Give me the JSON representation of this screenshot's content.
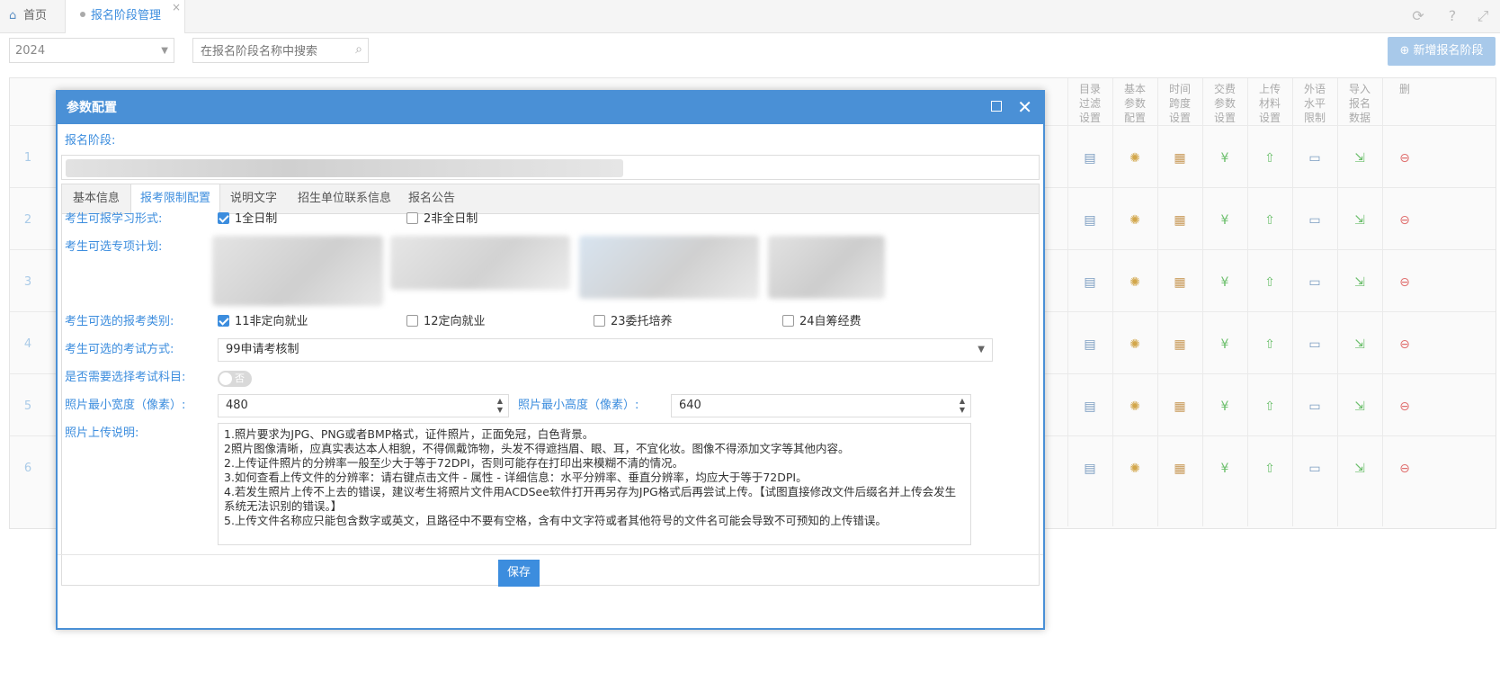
{
  "tabs": {
    "home": "首页",
    "active": "报名阶段管理"
  },
  "toolbar": {
    "year": "2024",
    "search_placeholder": "在报名阶段名称中搜索",
    "add_label": "新增报名阶段"
  },
  "grid": {
    "columns": [
      "目录\n过滤\n设置",
      "基本\n参数\n配置",
      "时间\n跨度\n设置",
      "交费\n参数\n设置",
      "上传\n材料\n设置",
      "外语\n水平\n限制",
      "导入\n报名\n数据",
      "删"
    ],
    "rows": [
      "1",
      "2",
      "3",
      "4",
      "5",
      "6"
    ]
  },
  "modal": {
    "title": "参数配置",
    "stage_label": "报名阶段:",
    "tabs": [
      "基本信息",
      "报考限制配置",
      "说明文字",
      "招生单位联系信息",
      "报名公告"
    ],
    "study_form_label": "考生可报学习形式:",
    "study_forms": [
      {
        "label": "1全日制",
        "checked": true
      },
      {
        "label": "2非全日制",
        "checked": false
      }
    ],
    "special_plan_label": "考生可选专项计划:",
    "category_label": "考生可选的报考类别:",
    "categories": [
      {
        "label": "11非定向就业",
        "checked": true
      },
      {
        "label": "12定向就业",
        "checked": false
      },
      {
        "label": "23委托培养",
        "checked": false
      },
      {
        "label": "24自筹经费",
        "checked": false
      }
    ],
    "exam_mode_label": "考生可选的考试方式:",
    "exam_mode_value": "99申请考核制",
    "subject_label": "是否需要选择考试科目:",
    "subject_toggle": "否",
    "min_width_label": "照片最小宽度（像素）:",
    "min_width_value": "480",
    "min_height_label": "照片最小高度（像素）:",
    "min_height_value": "640",
    "photo_desc_label": "照片上传说明:",
    "photo_desc": [
      "1.照片要求为JPG、PNG或者BMP格式，证件照片，正面免冠，白色背景。",
      "2照片图像清晰，应真实表达本人相貌，不得佩戴饰物，头发不得遮挡眉、眼、耳，不宜化妆。图像不得添加文字等其他内容。",
      "2.上传证件照片的分辨率一般至少大于等于72DPI，否则可能存在打印出来模糊不清的情况。",
      "3.如何查看上传文件的分辨率：请右键点击文件 - 属性 - 详细信息：水平分辨率、垂直分辨率，均应大于等于72DPI。",
      "4.若发生照片上传不上去的错误，建议考生将照片文件用ACDSee软件打开再另存为JPG格式后再尝试上传。【试图直接修改文件后缀名并上传会发生系统无法识别的错误。】",
      "5.上传文件名称应只能包含数字或英文，且路径中不要有空格，含有中文字符或者其他符号的文件名可能会导致不可预知的上传错误。"
    ],
    "save_label": "保存"
  }
}
